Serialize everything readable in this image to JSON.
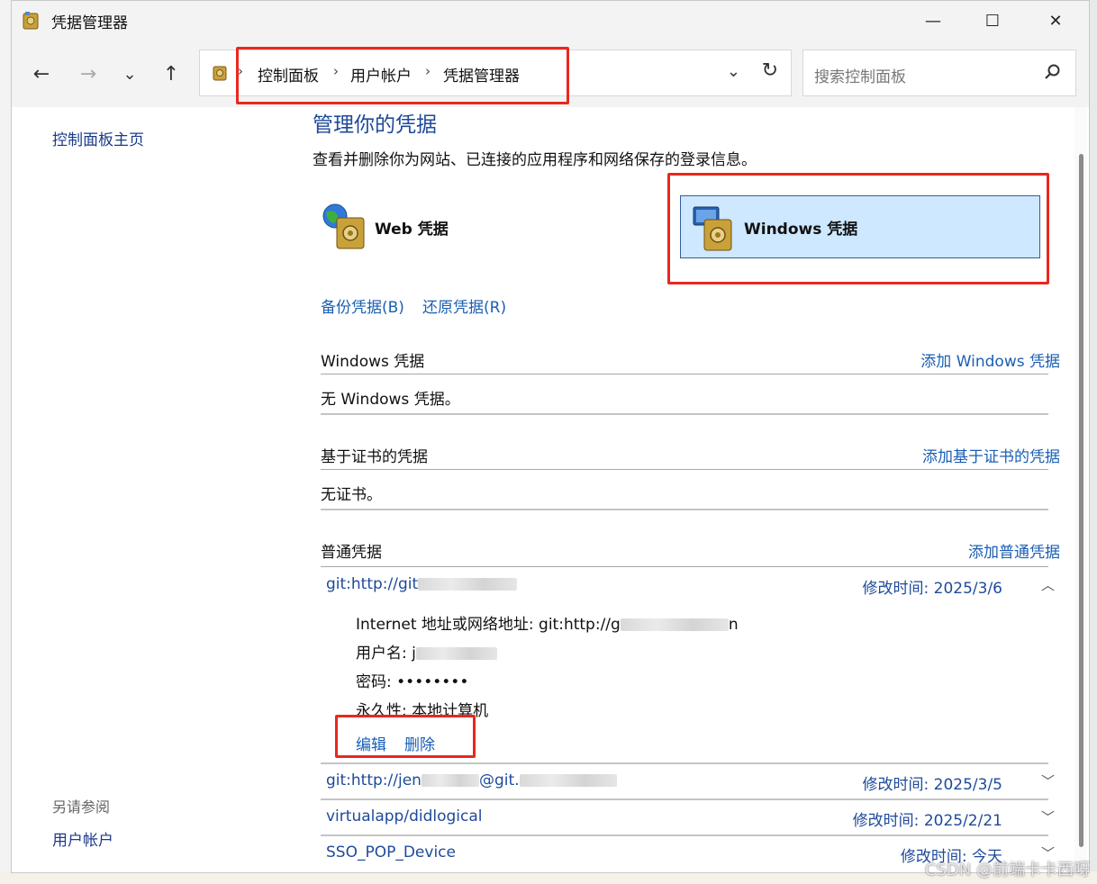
{
  "window": {
    "title": "凭据管理器",
    "minimize_glyph": "—",
    "maximize_glyph": "☐",
    "close_glyph": "✕"
  },
  "nav": {
    "back_glyph": "←",
    "forward_glyph": "→",
    "recent_glyph": "⌄",
    "up_glyph": "↑"
  },
  "address": {
    "crumbs": [
      "控制面板",
      "用户帐户",
      "凭据管理器"
    ],
    "separator": "›",
    "dropdown_glyph": "⌄",
    "refresh_glyph": "↻"
  },
  "search": {
    "placeholder": "搜索控制面板"
  },
  "sidebar": {
    "home_link": "控制面板主页",
    "see_also_heading": "另请参阅",
    "see_also_link": "用户帐户"
  },
  "main": {
    "title": "管理你的凭据",
    "description": "查看并删除你为网站、已连接的应用程序和网络保存的登录信息。",
    "tiles": {
      "web_label": "Web 凭据",
      "windows_label": "Windows 凭据"
    },
    "backup_link": "备份凭据(B)",
    "restore_link": "还原凭据(R)",
    "sections": {
      "windows": {
        "title": "Windows 凭据",
        "add": "添加 Windows 凭据",
        "empty": "无 Windows 凭据。"
      },
      "cert": {
        "title": "基于证书的凭据",
        "add": "添加基于证书的凭据",
        "empty": "无证书。"
      },
      "generic": {
        "title": "普通凭据",
        "add": "添加普通凭据"
      }
    },
    "credentials": [
      {
        "name": "git:http://git",
        "modified": "修改时间:  2025/3/6",
        "expanded": true
      },
      {
        "name_a": "git:http://jen",
        "name_b": "@git.",
        "modified": "修改时间:  2025/3/5"
      },
      {
        "name": "virtualapp/didlogical",
        "modified": "修改时间:  2025/2/21"
      },
      {
        "name": "SSO_POP_Device",
        "modified": "修改时间:  今天"
      }
    ],
    "details": {
      "address_label": "Internet 地址或网络地址:",
      "address_value_a": "git:http://g",
      "address_value_b": "n",
      "username_label": "用户名:",
      "username_value": "j",
      "password_label": "密码:",
      "password_value": "••••••••",
      "persistence_label": "永久性:",
      "persistence_value": "本地计算机",
      "edit_link": "编辑",
      "delete_link": "删除"
    },
    "chevron_up": "︿",
    "chevron_down": "﹀"
  },
  "watermark": "CSDN @前端卡卡西呀",
  "colors": {
    "link": "#1a5fb4",
    "highlight_box": "#e8281e",
    "selected_tile": "#cde8ff"
  }
}
